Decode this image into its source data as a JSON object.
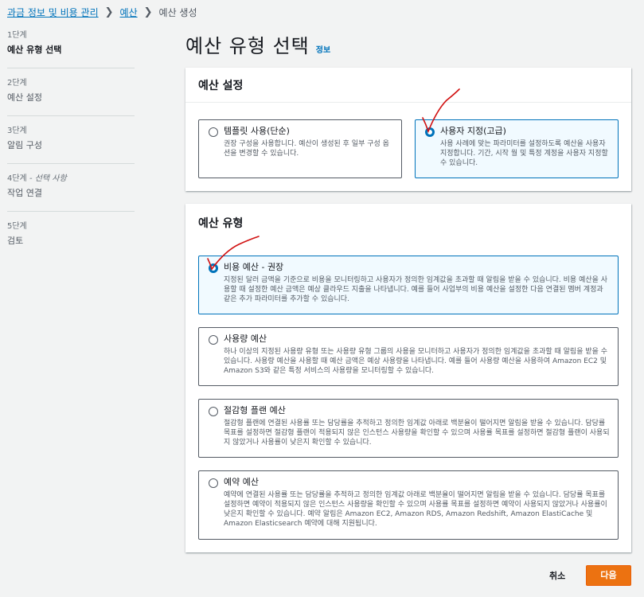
{
  "breadcrumb": {
    "items": [
      "과금 정보 및 비용 관리",
      "예산",
      "예산 생성"
    ]
  },
  "steps": [
    {
      "num": "1단계",
      "suffix": "",
      "label": "예산 유형 선택",
      "active": true
    },
    {
      "num": "2단계",
      "suffix": "",
      "label": "예산 설정",
      "active": false
    },
    {
      "num": "3단계",
      "suffix": "",
      "label": "알림 구성",
      "active": false
    },
    {
      "num": "4단계",
      "suffix": " - 선택 사항",
      "label": "작업 연결",
      "active": false
    },
    {
      "num": "5단계",
      "suffix": "",
      "label": "검토",
      "active": false
    }
  ],
  "page": {
    "title": "예산 유형 선택",
    "info": "정보"
  },
  "budget_setup": {
    "header": "예산 설정",
    "options": [
      {
        "title": "템플릿 사용(단순)",
        "desc": "권장 구성을 사용합니다. 예산이 생성된 후 일부 구성 옵션을 변경할 수 있습니다.",
        "selected": false
      },
      {
        "title": "사용자 지정(고급)",
        "desc": "사용 사례에 맞는 파라미터를 설정하도록 예산을 사용자 지정합니다. 기간, 시작 월 및 특정 계정을 사용자 지정할 수 있습니다.",
        "selected": true
      }
    ]
  },
  "budget_type": {
    "header": "예산 유형",
    "options": [
      {
        "title": "비용 예산 - 권장",
        "desc": "지정된 달러 금액을 기준으로 비용을 모니터링하고 사용자가 정의한 임계값을 초과할 때 알림을 받을 수 있습니다. 비용 예산을 사용할 때 설정한 예산 금액은 예상 클라우드 지출을 나타냅니다. 예를 들어 사업부의 비용 예산을 설정한 다음 연결된 멤버 계정과 같은 추가 파라미터를 추가할 수 있습니다.",
        "selected": true
      },
      {
        "title": "사용량 예산",
        "desc": "하나 이상의 지정된 사용량 유형 또는 사용량 유형 그룹의 사용을 모니터하고 사용자가 정의한 임계값을 초과할 때 알림을 받을 수 있습니다. 사용량 예산을 사용할 때 예산 금액은 예상 사용량을 나타냅니다. 예를 들어 사용량 예산을 사용하여 Amazon EC2 및 Amazon S3와 같은 특정 서비스의 사용량을 모니터링할 수 있습니다.",
        "selected": false
      },
      {
        "title": "절감형 플랜 예산",
        "desc": "절감형 플랜에 연결된 사용률 또는 담당률을 추적하고 정의한 임계값 아래로 백분율이 떨어지면 알림을 받을 수 있습니다. 담당률 목표를 설정하면 절감형 플랜이 적용되지 않은 인스턴스 사용량을 확인할 수 있으며 사용률 목표를 설정하면 절감형 플랜이 사용되지 않았거나 사용률이 낮은지 확인할 수 있습니다.",
        "selected": false
      },
      {
        "title": "예약 예산",
        "desc": "예약에 연결된 사용률 또는 담당률을 추적하고 정의한 임계값 아래로 백분율이 떨어지면 알림을 받을 수 있습니다. 담당률 목표를 설정하면 예약이 적용되지 않은 인스턴스 사용량을 확인할 수 있으며 사용률 목표를 설정하면 예약이 사용되지 않았거나 사용률이 낮은지 확인할 수 있습니다. 예약 알림은 Amazon EC2, Amazon RDS, Amazon Redshift, Amazon ElastiCache 및 Amazon Elasticsearch 예약에 대해 지원됩니다.",
        "selected": false
      }
    ]
  },
  "footer": {
    "cancel": "취소",
    "next": "다음"
  },
  "colors": {
    "accent": "#0073bb",
    "primary_button": "#ec7211",
    "annotation": "#d11111"
  }
}
